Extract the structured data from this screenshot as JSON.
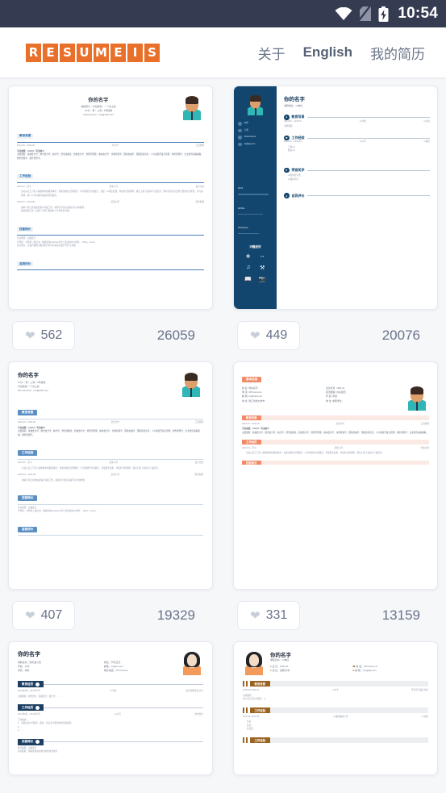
{
  "statusbar": {
    "time": "10:54",
    "wifi_icon": "wifi-icon",
    "sim_icon": "no-sim-icon",
    "battery_icon": "battery-charging-icon"
  },
  "header": {
    "logo_text": "RESUMEIS",
    "nav": [
      {
        "label": "关于",
        "name": "nav-about"
      },
      {
        "label": "English",
        "name": "nav-english"
      },
      {
        "label": "我的简历",
        "name": "nav-my-resume"
      }
    ]
  },
  "templates": [
    {
      "id": 1,
      "likes": "562",
      "views": "26059",
      "heart_icon": "heart-icon",
      "name": "你的名字",
      "tagline": "诚耿努力｜行动有效｜一个向上的",
      "line2": "XX岁｜男｜上海｜6年经验",
      "line3": "131xxxxxxxx｜xxx@163.com",
      "sections": [
        {
          "title": "教育背景",
          "rows": [
            {
              "left": "2012-09 ~ 2016-06",
              "mid": "XX大学",
              "right": "工商管理"
            }
          ],
          "paras": [
            "专业成绩：3.9/4.0（专业前3）",
            "主要课程：基础会计学、财务会计学、统计学、经济法概论、结构会计学、管理学原理、成本会计学、市场营销学、国际金融学、国际贸易实务、人力资源开发与管理、财务管理学、企业经营决策模拟、财务管理学、统计经济学。"
          ]
        },
        {
          "title": "工作经验",
          "rows": [
            {
              "left": "2016-09 ~ 至今",
              "mid": "某某公司",
              "right": "会计主管"
            }
          ],
          "bullets": [
            "负责从员工引导入职整体扣除报销事务，各类出纳及计算费用，公司的财务分析报告，月度｜xx报告结果，年度的计划预算，通过上级下达指令下发任务，同时分析各业务部门费用的合理性，并与其监督，减少公司可能存在运营风险发生。"
          ],
          "rows2": [
            {
              "left": "2015-09 ~ 2016-08",
              "mid": "某某公司",
              "right": "财务助理"
            }
          ],
          "bullets2": [
            "协助公司日常出纳及客户对账工作，协助引导供应商进行对分向检测。",
            "失败起稿工作，接收人手部门收银外人计销金会计报。"
          ]
        },
        {
          "title": "技能特长",
          "paras": [
            "证书经历：初级会计",
            "计算机：计算机二级证书，熟练使用windows平台上及常用办公软件， Office、Excel。",
            "语言能力：英语六级能力和流利与外可持用英文进行写作与沟通。"
          ]
        },
        {
          "title": "自我评价"
        }
      ]
    },
    {
      "id": 2,
      "likes": "449",
      "views": "20076",
      "heart_icon": "heart-icon",
      "name": "你的名字",
      "tagline": "求职岗位：xx岗位",
      "contacts": [
        "25岁",
        "上海",
        "131xxxxxxxx",
        "xx@qq.com"
      ],
      "skills": [
        "Word",
        "EXCEL",
        "Photoshop"
      ],
      "hobby_title": "兴趣爱好",
      "hobby_icons": [
        "snowflake-icon",
        "dumbbell-icon",
        "music-note-icon",
        "bicycle-icon",
        "book-icon",
        "camera-icon"
      ],
      "sections": [
        {
          "title": "教育背景",
          "rows": [
            {
              "left": "2014-09 ~ 2018-07",
              "mid": "xx学校",
              "right": "xx专业"
            }
          ],
          "paras": [
            "主修课程：. . . . . ."
          ]
        },
        {
          "title": "工作经验",
          "rows": [
            {
              "left": "2014-09 ~ 2018-07",
              "mid": "xx公司",
              "right": "xx职位"
            }
          ],
          "bullets": [
            "工作xxx",
            "职责xxx"
          ]
        },
        {
          "title": "荣誉奖学",
          "bullets": [
            "xx国家奖学金",
            "xx级好学生"
          ]
        },
        {
          "title": "自我评价"
        }
      ]
    },
    {
      "id": 3,
      "likes": "407",
      "views": "19329",
      "heart_icon": "heart-icon",
      "name": "你的名字",
      "line1": "XX岁｜男｜上海｜6年经验",
      "line2": "行动有效 一个向上的",
      "line3": "18×xxxxxxxx｜xxx@163.com",
      "sections": [
        {
          "title": "教育背景",
          "rows": [
            {
              "left": "2012-09 ~ 2016-06",
              "mid": "某某大学",
              "right": "工商管理"
            }
          ],
          "paras": [
            "专业成绩：3.9/4.0（专业前3）",
            "主要课程：基础会计学、财务会计学、统计学、经济法概论、结构会计学、管理学原理、成本会计学、市场营销学、国际金融学、国际贸易实务、人力资源开发与管理、财务管理学、企业经营决策模拟、财务管理学。"
          ]
        },
        {
          "title": "工作经验",
          "rows": [
            {
              "left": "2016-09 ~ 至今",
              "mid": "某某公司",
              "right": "会计主管"
            }
          ],
          "bullets": [
            "负责从员工引导入职整体扣除报销事务，各类出纳及计算费用，公司的财务分析报告，月度报告结果，年度的计划预算，通过上级下达指令下发任务。"
          ],
          "rows2": [
            {
              "left": "2015-09 ~ 2016-08",
              "mid": "某某公司",
              "right": "财务助理"
            }
          ],
          "bullets2": [
            "协助公司日常出纳及客户对账工作，协助引导供应商进行对分向检测。"
          ]
        },
        {
          "title": "技能特长",
          "paras": [
            "证书经历：初级会计",
            "计算机：计算机二级证书，熟练使用windows平台上及常用办公软件， Office、Excel。"
          ]
        },
        {
          "title": "自我评价"
        }
      ]
    },
    {
      "id": 4,
      "likes": "331",
      "views": "13159",
      "heart_icon": "heart-icon",
      "header_tag": "基本信息",
      "info": [
        {
          "k": "姓    名",
          "v": "你的名字"
        },
        {
          "k": "出生年月",
          "v": "1991.01"
        },
        {
          "k": "电    话",
          "v": "187xxxxxxxx"
        },
        {
          "k": "政治面貌",
          "v": "共青团员"
        },
        {
          "k": "邮    箱",
          "v": "xx@163.com"
        },
        {
          "k": "年    龄",
          "v": "年级"
        },
        {
          "k": "地    址",
          "v": "浙江省杭州市市"
        },
        {
          "k": "岗    位",
          "v": "求职学生"
        }
      ],
      "sections": [
        {
          "title": "教育背景",
          "rows": [
            {
              "left": "2012-09 ~ 2016-06",
              "mid": "某某大学",
              "right": "工商管理"
            }
          ],
          "paras": [
            "专业成绩：3.9/4.0（专业前3）",
            "主要课程：基础会计学、财务会计学、统计学、经济法概论、结构会计学、管理学原理、成本会计学、市场营销学、国际金融学、国际贸易实务、人力资源开发与管理、财务管理学、企业经营决策模拟。"
          ]
        },
        {
          "title": "工作经历",
          "rows": [
            {
              "left": "2016-09 ~ 至今",
              "mid": "某某公司",
              "right": "行政主管"
            }
          ],
          "bullets": [
            "负责从员工引导入职整体扣除报销事务，各类出纳及计算费用，公司的财务分析报告，月度报告结果，年度的计划预算，通过上级下达指令下发任务。"
          ]
        },
        {
          "title": "技能特长"
        }
      ]
    },
    {
      "id": 5,
      "name": "你的名字",
      "info": [
        {
          "k": "求职意向：",
          "v": "财务会计员"
        },
        {
          "k": "岗位：",
          "v": "节约正式"
        },
        {
          "k": "年龄：",
          "v": "25岁"
        },
        {
          "k": "邮箱：",
          "v": "xx@xx.com"
        },
        {
          "k": "学历：",
          "v": "本科"
        },
        {
          "k": "联系电话：",
          "v": "137771xxxx"
        }
      ],
      "sections": [
        {
          "title": "教育经历",
          "rows": [
            {
              "left": "2013年9月 ~ 2017年7月",
              "mid": "xx学校",
              "right": "会计管理专业/学士"
            }
          ],
          "paras": [
            "主修课程：财务会计、基础会计、统计学. . . . . ."
          ]
        },
        {
          "title": "工作经历",
          "rows": [
            {
              "left": "2017年9月 ~ 2017年7月",
              "mid": "xx公司",
              "right": "财务会计"
            }
          ],
          "paras": [
            "工作描述：",
            "1、主要负责公司账务、报表、每日水平费用的核销及报销",
            "2、. . .",
            "3、. . ."
          ]
        },
        {
          "title": "技能特长",
          "paras": [
            "会计职称：初级会计",
            "专业技能：熟练使用用友财务软件进行账务"
          ]
        }
      ]
    },
    {
      "id": 6,
      "name": "你的名字",
      "tagline": "求职意向：xx岗位",
      "info": [
        {
          "icon": "person-icon",
          "k": "生  日：",
          "v": "1991.01"
        },
        {
          "icon": "phone-icon",
          "k": "电  话：",
          "v": "137xxxxxx.xx"
        },
        {
          "icon": "location-icon",
          "k": "住  址：",
          "v": "合肥市/市"
        },
        {
          "icon": "mail-icon",
          "k": "邮  箱：",
          "v": "xxx@qq.com"
        }
      ],
      "sections": [
        {
          "title": "教育背景",
          "rows": [
            {
              "left": "2005.09~2009.07",
              "mid": "xx大学",
              "right": "环境艺术设计专业"
            }
          ],
          "paras": [
            "主修课程：",
            "每公司公司分平面流、xx"
          ]
        },
        {
          "title": "工作经验",
          "rows": [
            {
              "left": "2010.05~2016.08",
              "mid": "xx媒体集团公司",
              "right": "xx岗位"
            }
          ],
          "bullets": [
            "负责：. . .",
            "负责：. . .",
            "负责乱：. . ."
          ]
        },
        {
          "title": "工作经验"
        }
      ]
    }
  ]
}
